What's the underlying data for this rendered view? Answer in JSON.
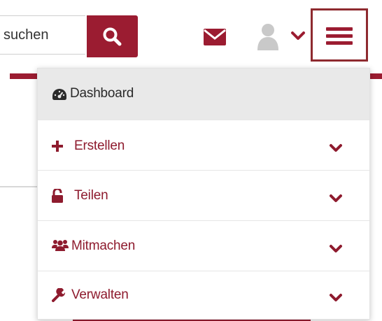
{
  "header": {
    "search": {
      "placeholder": "suchen",
      "button_icon": "search-icon"
    },
    "mail_icon": "envelope-icon",
    "user_menu": {
      "avatar_icon": "user-avatar-icon",
      "chevron_icon": "chevron-down-icon"
    },
    "menu_toggle_icon": "hamburger-icon"
  },
  "menu": {
    "items": [
      {
        "label": "Dashboard",
        "icon": "tachometer-icon",
        "active": true,
        "has_submenu": false
      },
      {
        "label": "Erstellen",
        "icon": "plus-icon",
        "active": false,
        "has_submenu": true
      },
      {
        "label": "Teilen",
        "icon": "unlock-icon",
        "active": false,
        "has_submenu": true
      },
      {
        "label": "Mitmachen",
        "icon": "users-icon",
        "active": false,
        "has_submenu": true
      },
      {
        "label": "Verwalten",
        "icon": "wrench-icon",
        "active": false,
        "has_submenu": true
      }
    ]
  },
  "colors": {
    "brand": "#9b1c31",
    "menu_active_bg": "#e9e9e9",
    "text_dark": "#2a2a2a"
  }
}
